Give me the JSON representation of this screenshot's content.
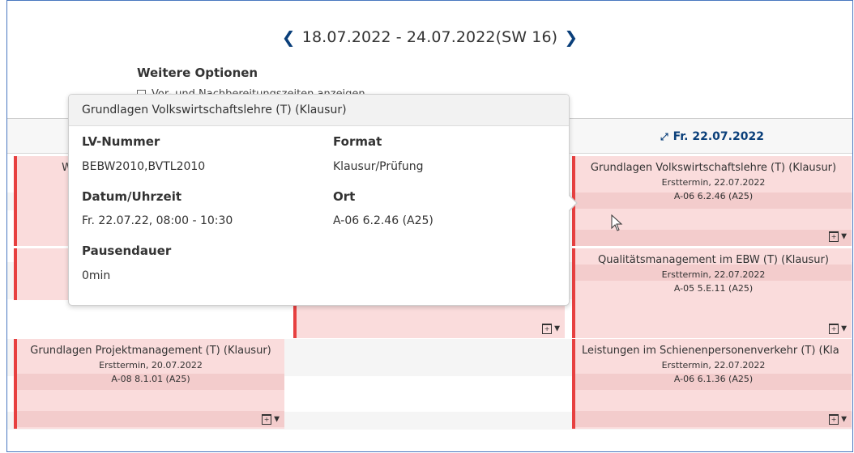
{
  "week": {
    "range": "18.07.2022 - 24.07.2022(SW 16)"
  },
  "options": {
    "title": "Weitere Optionen",
    "checkbox_label": "Vor- und Nachbereitungszeiten anzeigen"
  },
  "days": {
    "friday": "Fr. 22.07.2022"
  },
  "events": [
    {
      "title": "Grundlagen Volkswirtschaftslehre (T) (Klausur)",
      "sub": "Ersttermin, 22.07.2022",
      "loc": "A-06 6.2.46 (A25)"
    },
    {
      "title": "Qualitätsmanagement im EBW (T) (Klausur)",
      "sub": "Ersttermin, 22.07.2022",
      "loc": "A-05 5.E.11 (A25)"
    },
    {
      "title": "Leistungen im Schienenpersonenverkehr (T) (Kla",
      "sub": "Ersttermin, 22.07.2022",
      "loc": "A-06 6.1.36 (A25)"
    },
    {
      "title": "Grundlagen Projektmanagement (T) (Klausur)",
      "sub": "Ersttermin, 20.07.2022",
      "loc": "A-08 8.1.01 (A25)"
    },
    {
      "title": "W",
      "sub": "",
      "loc": ""
    }
  ],
  "popover": {
    "title": "Grundlagen Volkswirtschaftslehre (T) (Klausur)",
    "lv_label": "LV-Nummer",
    "lv_value": "BEBW2010,BVTL2010",
    "format_label": "Format",
    "format_value": "Klausur/Prüfung",
    "datum_label": "Datum/Uhrzeit",
    "datum_value": "Fr. 22.07.22, 08:00 - 10:30",
    "ort_label": "Ort",
    "ort_value": "A-06 6.2.46 (A25)",
    "pause_label": "Pausendauer",
    "pause_value": "0min"
  },
  "colors": {
    "accent": "#0a3f7a",
    "event_bg": "#fadcdc",
    "event_border": "#e74040"
  }
}
